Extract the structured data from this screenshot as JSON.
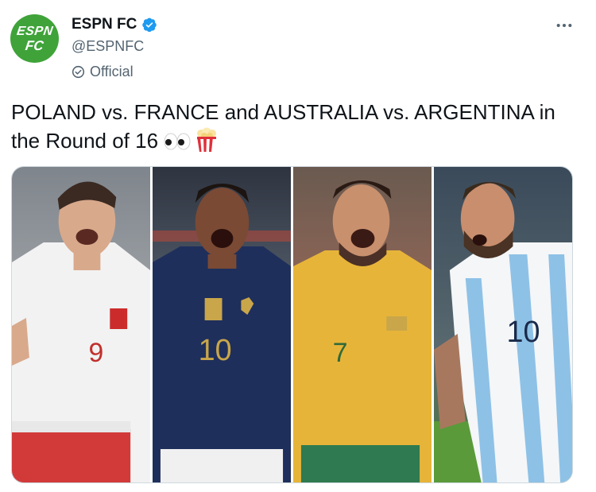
{
  "account": {
    "avatar_line1": "ESPN",
    "avatar_line2": "FC",
    "name": "ESPN FC",
    "handle": "@ESPNFC",
    "label": "Official"
  },
  "tweet": {
    "text": "POLAND vs. FRANCE and AUSTRALIA vs. ARGENTINA in the Round of 16"
  },
  "media": {
    "players": [
      {
        "team": "Poland",
        "number": "9"
      },
      {
        "team": "France",
        "number": "10"
      },
      {
        "team": "Australia",
        "number": "7"
      },
      {
        "team": "Argentina",
        "number": "10"
      }
    ]
  },
  "icons": {
    "verified": "verified-badge-icon",
    "official": "official-check-icon",
    "more": "more-dots-icon",
    "eyes": "eyes-emoji",
    "popcorn": "popcorn-emoji"
  },
  "colors": {
    "brand_green": "#3fa33a",
    "verified_blue": "#1d9bf0",
    "secondary_text": "#536471"
  }
}
